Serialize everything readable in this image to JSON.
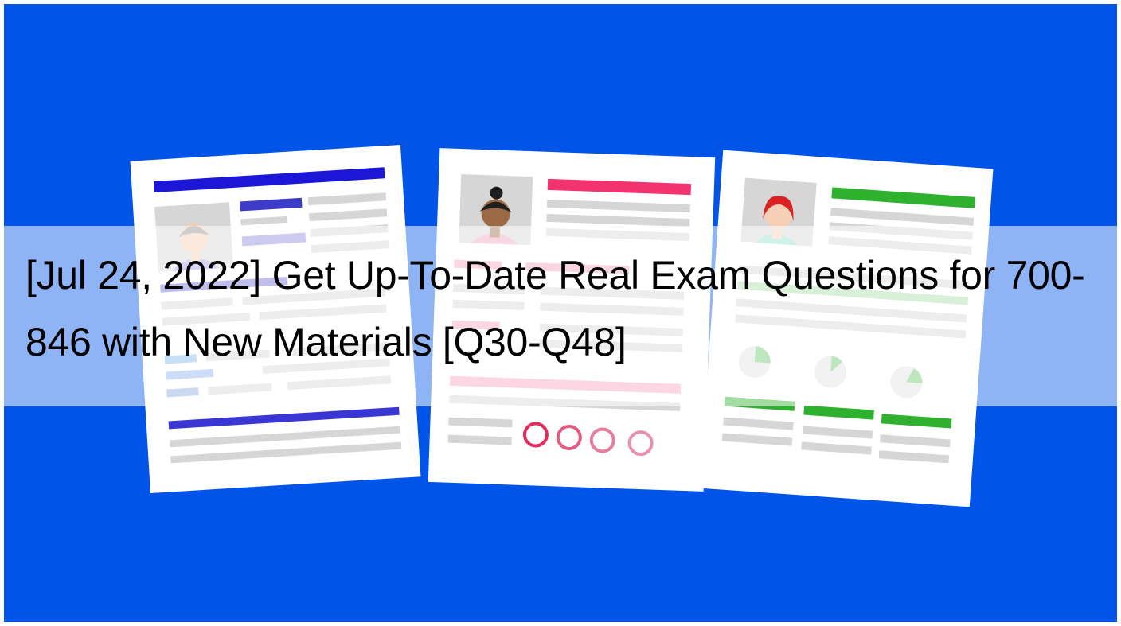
{
  "banner": {
    "title": "[Jul 24, 2022] Get Up-To-Date Real Exam Questions for 700-846 with New Materials [Q30-Q48]"
  },
  "illustration": {
    "subject": "three resume documents",
    "colors": {
      "background": "#0154E8",
      "left_accent": "#1C17D6",
      "middle_accent": "#F2336F",
      "right_accent": "#2FB12F",
      "paper": "#FFFFFF",
      "placeholder_line": "#D4D4D4"
    },
    "icons": [
      "gray-hair-avatar-icon",
      "curly-hair-avatar-icon",
      "red-hair-avatar-icon",
      "ring-chart-icon",
      "pie-chart-icon"
    ]
  }
}
